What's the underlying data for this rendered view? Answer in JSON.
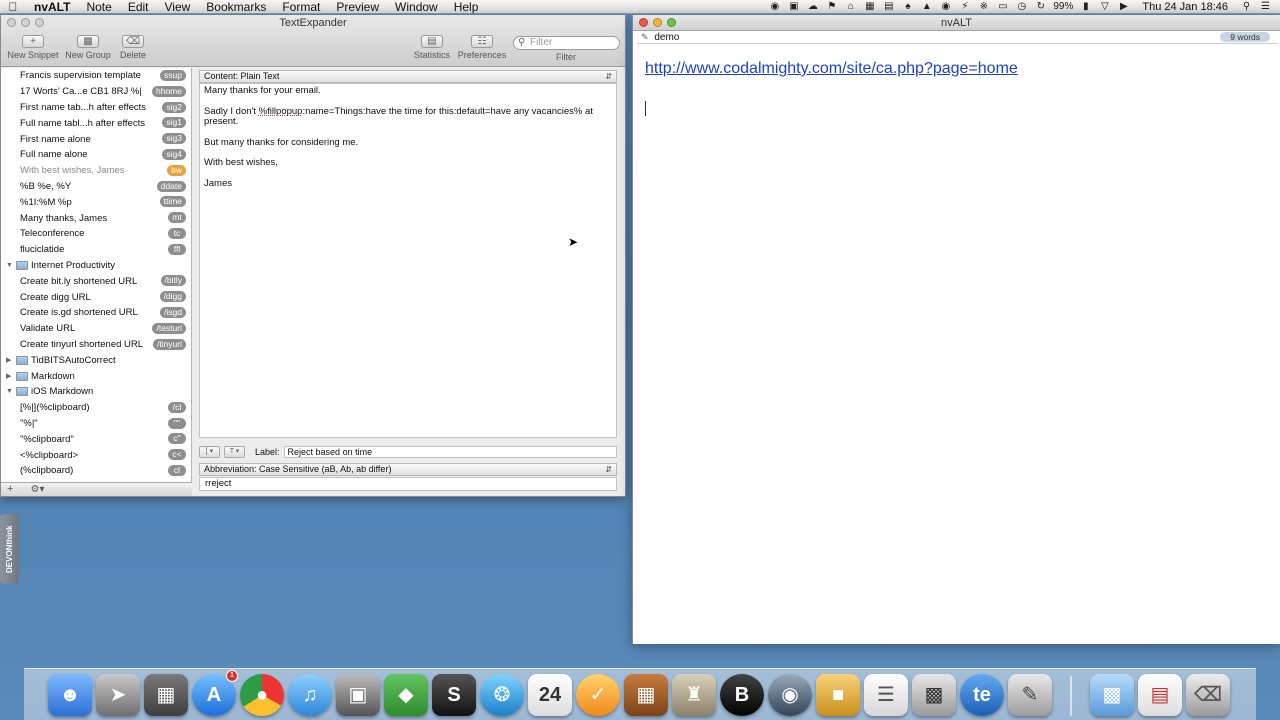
{
  "menubar": {
    "app_name": "nvALT",
    "items": [
      "Note",
      "Edit",
      "View",
      "Bookmarks",
      "Format",
      "Preview",
      "Window",
      "Help"
    ],
    "battery": "99%",
    "clock": "Thu 24 Jan  18:46"
  },
  "textexpander": {
    "title": "TextExpander",
    "toolbar": {
      "new_snippet": "New Snippet",
      "new_group": "New Group",
      "delete": "Delete",
      "statistics": "Statistics",
      "preferences": "Preferences",
      "filter_placeholder": "Filter",
      "filter_label": "Filter"
    },
    "snippets_top": [
      {
        "label": "Francis supervision template",
        "abbr": "ssup"
      },
      {
        "label": "17 Worts' Ca...e CB1 8RJ  %|",
        "abbr": "hhome"
      },
      {
        "label": "First name tab...h after effects",
        "abbr": "sig2"
      },
      {
        "label": "Full name tabl...h after effects",
        "abbr": "sig1"
      },
      {
        "label": "First name alone",
        "abbr": "sig3"
      },
      {
        "label": "Full name alone",
        "abbr": "sig4"
      },
      {
        "label": "With best wishes,  James",
        "abbr": "bw"
      },
      {
        "label": "%B %e, %Y",
        "abbr": "ddate"
      },
      {
        "label": "%1I:%M %p",
        "abbr": "ttime"
      },
      {
        "label": "Many thanks,  James",
        "abbr": "mt"
      },
      {
        "label": "Teleconference",
        "abbr": "tc"
      },
      {
        "label": "fluciclatide",
        "abbr": "ffl"
      }
    ],
    "group_internet": "Internet Productivity",
    "snippets_internet": [
      {
        "label": "Create bit.ly shortened URL",
        "abbr": "/bitly"
      },
      {
        "label": "Create digg URL",
        "abbr": "/digg"
      },
      {
        "label": "Create is.gd shortened URL",
        "abbr": "/isgd"
      },
      {
        "label": "Validate URL",
        "abbr": "/testurl"
      },
      {
        "label": "Create tinyurl shortened URL",
        "abbr": "/tinyurl"
      }
    ],
    "group_tidbits": "TidBITSAutoCorrect",
    "group_markdown": "Markdown",
    "group_ios_markdown": "iOS Markdown",
    "snippets_ios": [
      {
        "label": "[%|](%clipboard)",
        "abbr": "/cl"
      },
      {
        "label": "\"%|\"",
        "abbr": "\"\""
      },
      {
        "label": "\"%clipboard\"",
        "abbr": "c\""
      },
      {
        "label": "<%clipboard>",
        "abbr": "c<"
      },
      {
        "label": "(%clipboard)",
        "abbr": "cl"
      }
    ],
    "content_type": "Content: Plain Text",
    "content": {
      "line1": "Many thanks for your email.",
      "line2a": "Sadly I don't ",
      "line2b": "%fillpopup",
      "line2c": ":name=Things:have the time for this:default=have any vacancies% at present.",
      "line3": "But many thanks for considering me.",
      "line4": "With best wishes,",
      "line5": "James"
    },
    "label_caption": "Label:",
    "label_value": "Reject based on time",
    "abbreviation_mode": "Abbreviation: Case Sensitive (aB, Ab, ab differ)",
    "abbreviation_value": "rreject"
  },
  "nvalt": {
    "title": "nvALT",
    "search_value": "demo",
    "word_count": "9 words",
    "link": "http://www.codalmighty.com/site/ca.php?page=home"
  },
  "devon_tab": "DEVONthink",
  "dock": {
    "calendar_day": "24",
    "appstore_badge": "1",
    "te_label": "te",
    "bbedit_label": "B"
  },
  "colors": {
    "accent_link": "#1b3fd6",
    "badge_gray": "#8e8e8e",
    "badge_orange": "#e8a23a"
  }
}
